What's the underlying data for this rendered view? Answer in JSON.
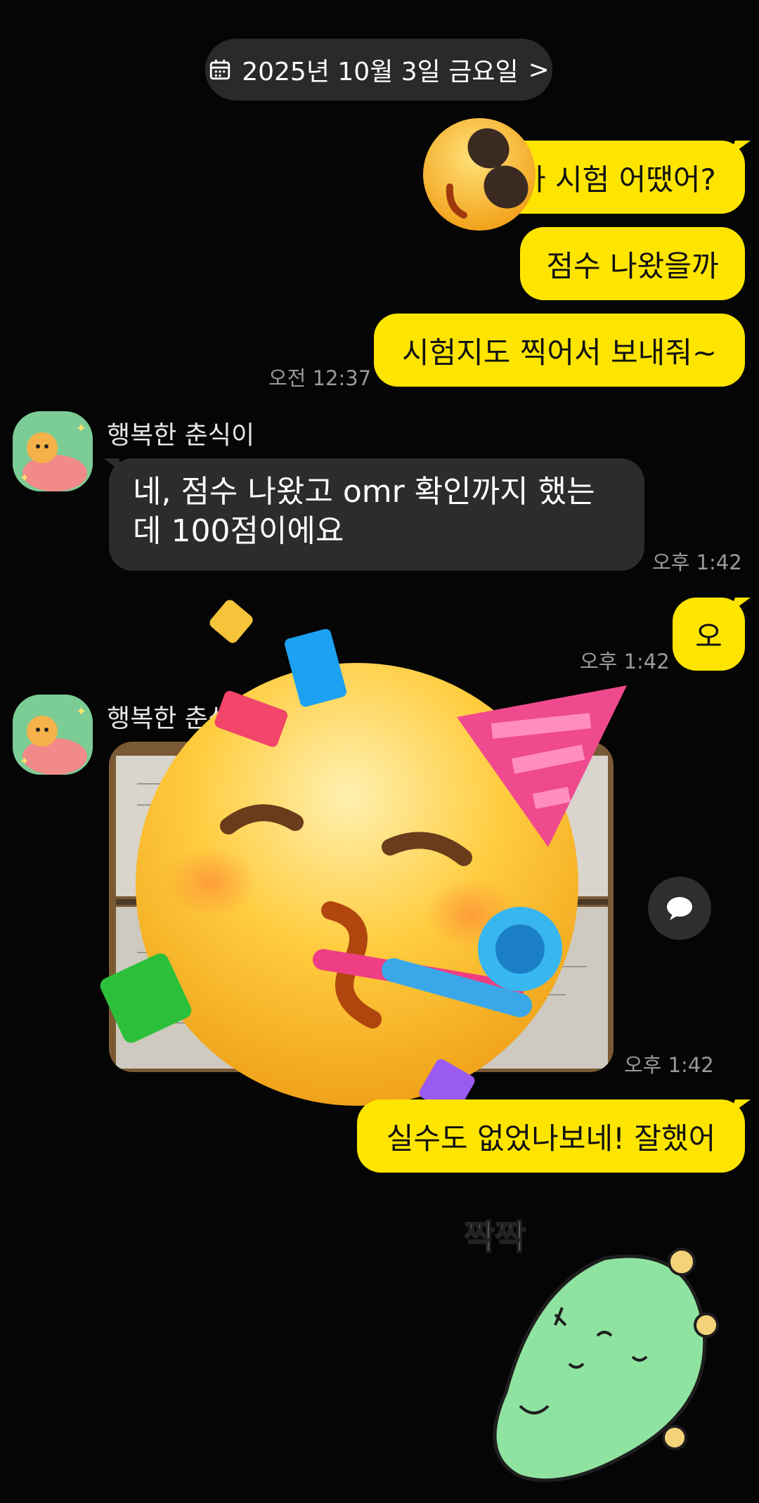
{
  "date_header": {
    "label": "2025년 10월 3일 금요일",
    "chevron": ">"
  },
  "messages": [
    {
      "text": "아 시험 어땠어?"
    },
    {
      "text": "점수 나왔을까"
    },
    {
      "text": "시험지도 찍어서 보내줘~",
      "time": "오전 12:37"
    },
    {
      "sender": "행복한 춘식이",
      "text": "네, 점수 나왔고 omr 확인까지 했는데 100점이에요",
      "time": "오후 1:42"
    },
    {
      "text": "오",
      "time": "오후 1:42"
    },
    {
      "sender": "행복한 춘식이",
      "time": "오후 1:42"
    },
    {
      "text": "실수도 없었나보네! 잘했어"
    }
  ],
  "sticker": {
    "caption": "짝짝"
  },
  "icons": {
    "calendar": "calendar-icon",
    "share": "speech-bubble-icon",
    "sunglasses_emoji": "sunglasses-emoji",
    "party_emoji": "party-face-emoji"
  },
  "colors": {
    "my_bubble": "#fee500",
    "other_bubble": "#2c2c2c",
    "background": "#050505"
  }
}
